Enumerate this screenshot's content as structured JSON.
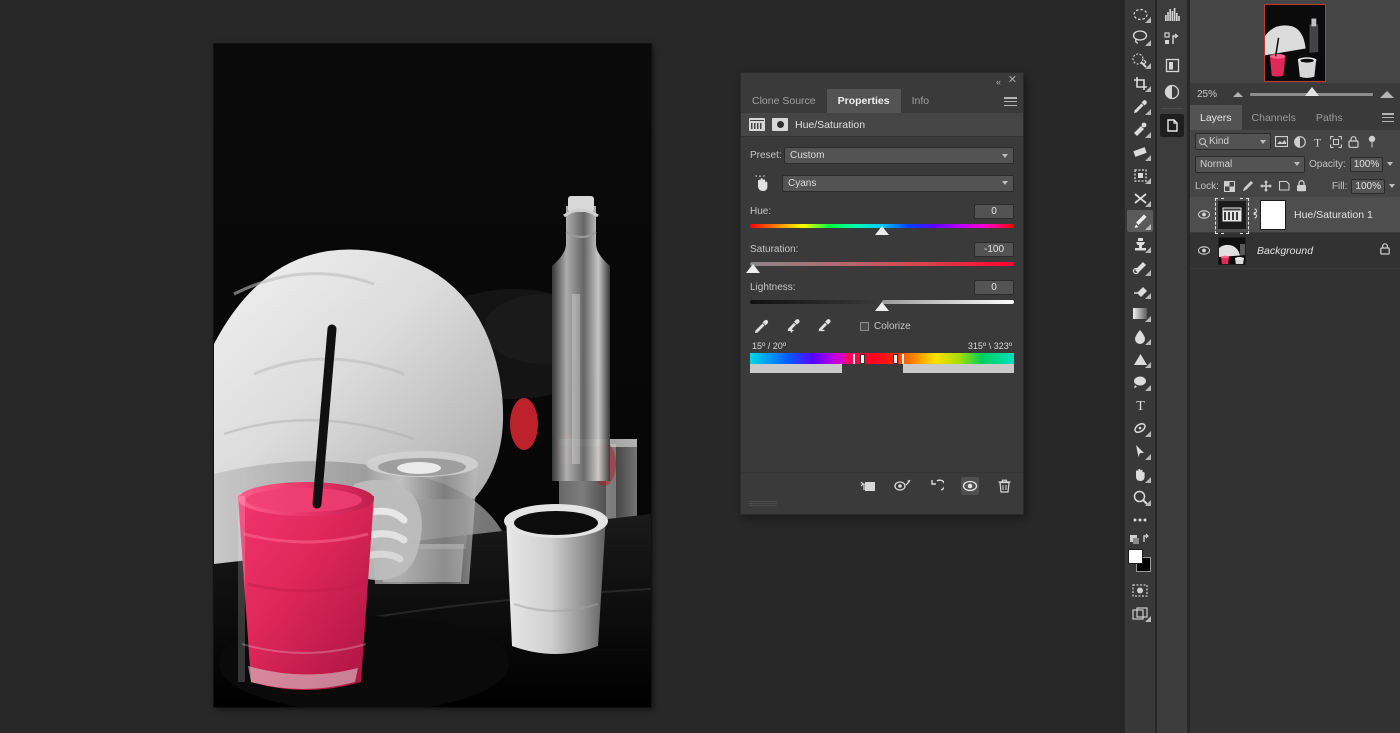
{
  "app": {
    "name": "Adobe Photoshop",
    "background_color": "#282828"
  },
  "document": {
    "zoom": "25%",
    "canvas": {
      "description": "Selective-color photo: person in white shirt at a dark table with a pink smoothie in a glass with a black straw, a clear glass of water, a tall bottle with swing top, and a white mug of dark coffee",
      "accent_color": "#e0285a"
    }
  },
  "navigator": {
    "zoom_label": "25%",
    "zoom_out_icon": "mountain-small-icon",
    "zoom_in_icon": "mountain-large-icon",
    "slider_position_percent": 50
  },
  "toolbar": {
    "tools": [
      {
        "name": "marquee-rect-tool",
        "glyph": "▭"
      },
      {
        "name": "lasso-tool",
        "glyph": "◯"
      },
      {
        "name": "quick-selection-tool",
        "glyph": "✦"
      },
      {
        "name": "crop-tool",
        "glyph": "⌗"
      },
      {
        "name": "eyedropper-tool",
        "glyph": "⚲"
      },
      {
        "name": "spot-healing-tool",
        "glyph": "✂"
      },
      {
        "name": "patch-tool",
        "glyph": "▤"
      },
      {
        "name": "content-aware-move-tool",
        "glyph": "▦"
      },
      {
        "name": "red-eye-tool",
        "glyph": "✕"
      },
      {
        "name": "brush-tool",
        "glyph": "🖌",
        "active": true
      },
      {
        "name": "clone-stamp-tool",
        "glyph": "⎙"
      },
      {
        "name": "history-brush-tool",
        "glyph": "✎"
      },
      {
        "name": "eraser-tool",
        "glyph": "◧"
      },
      {
        "name": "gradient-tool",
        "glyph": "▬"
      },
      {
        "name": "blur-tool",
        "glyph": "💧"
      },
      {
        "name": "dodge-tool",
        "glyph": "▲"
      },
      {
        "name": "pen-tool",
        "glyph": "✒"
      },
      {
        "name": "type-tool",
        "glyph": "T"
      },
      {
        "name": "path-selection-tool",
        "glyph": "↗"
      },
      {
        "name": "direct-selection-tool",
        "glyph": "▷"
      },
      {
        "name": "hand-tool",
        "glyph": "✋"
      },
      {
        "name": "zoom-tool",
        "glyph": "🔍"
      },
      {
        "name": "edit-toolbar-button",
        "glyph": "…"
      }
    ],
    "foreground_color": "#ffffff",
    "background_color": "#000000",
    "quick_mask_icon": "quick-mask-icon",
    "screen_mode_icon": "screen-mode-icon"
  },
  "mini_dock": {
    "items": [
      {
        "name": "histogram-panel-icon",
        "active": false
      },
      {
        "name": "history-panel-icon",
        "active": false
      },
      {
        "name": "layer-comps-panel-icon",
        "active": false
      },
      {
        "name": "adjustments-panel-icon",
        "active": false
      },
      {
        "name": "properties-panel-icon",
        "active": true
      }
    ]
  },
  "properties_panel": {
    "tabs": [
      {
        "label": "Clone Source",
        "active": false
      },
      {
        "label": "Properties",
        "active": true
      },
      {
        "label": "Info",
        "active": false
      }
    ],
    "menu_icon": "panel-menu-icon",
    "collapse_icon": "collapse-double-arrow-icon",
    "close_icon": "close-icon",
    "adjustment": {
      "title": "Hue/Saturation",
      "layer_icon": "hue-saturation-icon",
      "mask_icon": "mask-icon"
    },
    "preset": {
      "label": "Preset:",
      "value": "Custom"
    },
    "channel": {
      "value": "Cyans",
      "hand_icon": "on-image-adjust-icon"
    },
    "sliders": [
      {
        "name": "Hue:",
        "value": "0",
        "thumb_percent": 50,
        "track": "hue"
      },
      {
        "name": "Saturation:",
        "value": "-100",
        "thumb_percent": 1,
        "track": "saturation"
      },
      {
        "name": "Lightness:",
        "value": "0",
        "thumb_percent": 50,
        "track": "lightness"
      }
    ],
    "eyedroppers": [
      {
        "name": "eyedropper-icon"
      },
      {
        "name": "eyedropper-add-icon"
      },
      {
        "name": "eyedropper-subtract-icon"
      }
    ],
    "colorize": {
      "label": "Colorize",
      "checked": false
    },
    "color_range": {
      "left_label": "15º / 20º",
      "right_label": "315º \\ 323º"
    },
    "footer_icons": [
      {
        "name": "clip-to-layer-icon",
        "active": false
      },
      {
        "name": "view-previous-state-icon",
        "active": false
      },
      {
        "name": "reset-adjustment-icon",
        "active": false
      },
      {
        "name": "toggle-layer-visibility-icon",
        "active": true
      },
      {
        "name": "delete-adjustment-icon",
        "active": false
      }
    ]
  },
  "layers_panel": {
    "tabs": [
      {
        "label": "Layers",
        "active": true
      },
      {
        "label": "Channels",
        "active": false
      },
      {
        "label": "Paths",
        "active": false
      }
    ],
    "menu_icon": "panel-menu-icon",
    "filter": {
      "kind_label": "Kind",
      "search_icon": "search-icon",
      "icons": [
        {
          "name": "filter-pixel-icon"
        },
        {
          "name": "filter-adjustment-icon"
        },
        {
          "name": "filter-type-icon"
        },
        {
          "name": "filter-shape-icon"
        },
        {
          "name": "filter-smart-object-icon"
        }
      ],
      "toggle_icon": "filter-toggle-icon"
    },
    "blend": {
      "mode": "Normal",
      "opacity_label": "Opacity:",
      "opacity_value": "100%"
    },
    "lock": {
      "label": "Lock:",
      "icons": [
        {
          "name": "lock-transparency-icon"
        },
        {
          "name": "lock-image-icon"
        },
        {
          "name": "lock-position-icon"
        },
        {
          "name": "lock-artboard-icon"
        },
        {
          "name": "lock-all-icon"
        }
      ],
      "fill_label": "Fill:",
      "fill_value": "100%"
    },
    "layers": [
      {
        "name": "Hue/Saturation 1",
        "type": "adjustment",
        "selected": true,
        "visible": true,
        "italic": false,
        "locked": false,
        "has_mask": true,
        "link_icon": "link-icon"
      },
      {
        "name": "Background",
        "type": "image",
        "selected": false,
        "visible": true,
        "italic": true,
        "locked": true,
        "has_mask": false,
        "lock_icon": "lock-icon"
      }
    ]
  }
}
